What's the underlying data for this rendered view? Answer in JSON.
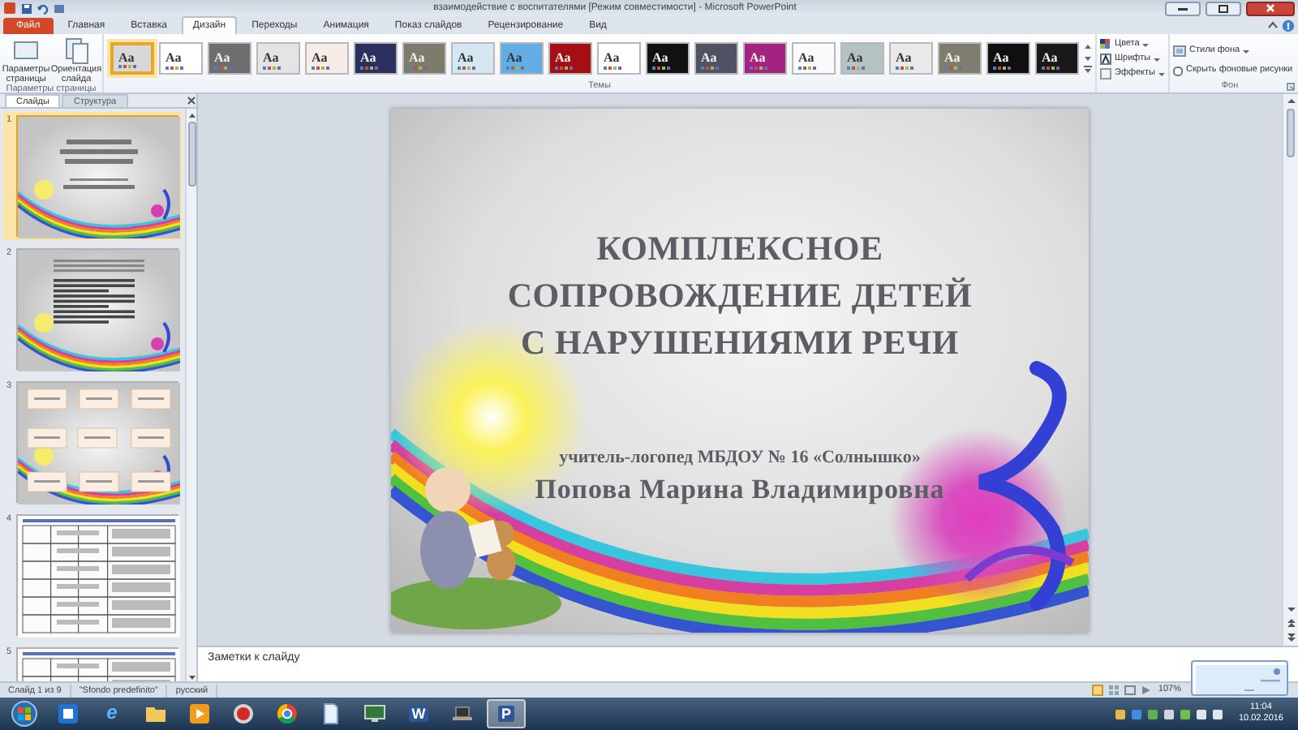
{
  "window": {
    "title": "взаимодействие с воспитателями [Режим совместимости] - Microsoft PowerPoint"
  },
  "ribbon_tabs": [
    {
      "label": "Файл",
      "kind": "file",
      "selected": false
    },
    {
      "label": "Главная",
      "kind": "tab",
      "selected": false
    },
    {
      "label": "Вставка",
      "kind": "tab",
      "selected": false
    },
    {
      "label": "Дизайн",
      "kind": "tab",
      "selected": true
    },
    {
      "label": "Переходы",
      "kind": "tab",
      "selected": false
    },
    {
      "label": "Анимация",
      "kind": "tab",
      "selected": false
    },
    {
      "label": "Показ слайдов",
      "kind": "tab",
      "selected": false
    },
    {
      "label": "Рецензирование",
      "kind": "tab",
      "selected": false
    },
    {
      "label": "Вид",
      "kind": "tab",
      "selected": false
    }
  ],
  "page_setup": {
    "label": "Параметры страницы",
    "buttons": [
      {
        "label": "Параметры страницы",
        "kind": "page"
      },
      {
        "label": "Ориентация слайда",
        "kind": "orientation"
      }
    ]
  },
  "themes": {
    "label": "Темы",
    "items": [
      {
        "label": "Aa",
        "color": "#d8d8d8",
        "selected": true
      },
      {
        "label": "Aa",
        "color": "#ffffff",
        "selected": false
      },
      {
        "label": "Aa",
        "color": "#6e6e70",
        "selected": false
      },
      {
        "label": "Aa",
        "color": "#e4e4e4",
        "selected": false
      },
      {
        "label": "Aa",
        "color": "#f7ece6",
        "selected": false
      },
      {
        "label": "Aa",
        "color": "#2b2f5c",
        "selected": false
      },
      {
        "label": "Aa",
        "color": "#7c7b6c",
        "selected": false
      },
      {
        "label": "Aa",
        "color": "#d5e7f3",
        "selected": false
      },
      {
        "label": "Aa",
        "color": "#62aee4",
        "selected": false
      },
      {
        "label": "Aa",
        "color": "#a30f12",
        "selected": false
      },
      {
        "label": "Aa",
        "color": "#ffffff",
        "selected": false
      },
      {
        "label": "Aa",
        "color": "#111111",
        "selected": false
      },
      {
        "label": "Aa",
        "color": "#4f5262",
        "selected": false
      },
      {
        "label": "Aa",
        "color": "#a32381",
        "selected": false
      },
      {
        "label": "Aa",
        "color": "#fafafa",
        "selected": false
      },
      {
        "label": "Aa",
        "color": "#b4c2c4",
        "selected": false
      },
      {
        "label": "Aa",
        "color": "#e9e9e9",
        "selected": false
      },
      {
        "label": "Aa",
        "color": "#7f7e6e",
        "selected": false
      },
      {
        "label": "Aa",
        "color": "#0f0f12",
        "selected": false
      },
      {
        "label": "Aa",
        "color": "#191919",
        "selected": false
      }
    ]
  },
  "theme_options": [
    {
      "label": "Цвета",
      "kind": "colors"
    },
    {
      "label": "Шрифты",
      "kind": "fonts"
    },
    {
      "label": "Эффекты",
      "kind": "effects"
    }
  ],
  "background": {
    "label": "Фон",
    "styles_button": "Стили фона",
    "hide_graphics": {
      "label": "Скрыть фоновые рисунки",
      "checked": false
    }
  },
  "pane_tabs": [
    {
      "label": "Слайды",
      "selected": true
    },
    {
      "label": "Структура",
      "selected": false
    }
  ],
  "slides": [
    {
      "number": "1",
      "kind": "title",
      "selected": true
    },
    {
      "number": "2",
      "kind": "text",
      "selected": false
    },
    {
      "number": "3",
      "kind": "diagram",
      "selected": false
    },
    {
      "number": "4",
      "kind": "table",
      "selected": false
    },
    {
      "number": "5",
      "kind": "table",
      "selected": false
    }
  ],
  "slide": {
    "title": "КОМПЛЕКСНОЕ\nСОПРОВОЖДЕНИЕ ДЕТЕЙ\nС НАРУШЕНИЯМИ РЕЧИ",
    "subtitle": "учитель-логопед МБДОУ  № 16 «Солнышко»",
    "author": "Попова Марина Владимировна"
  },
  "notes": {
    "placeholder": "Заметки к слайду"
  },
  "status_bar": {
    "slide": "Слайд 1 из 9",
    "theme": "\"Sfondo predefinito\"",
    "language": "русский",
    "zoom": "107%"
  },
  "taskbar": {
    "apps": [
      {
        "kind": "window",
        "selected": false
      },
      {
        "kind": "browser",
        "label": "e",
        "selected": false
      },
      {
        "kind": "folder",
        "selected": false
      },
      {
        "kind": "play",
        "selected": false
      },
      {
        "kind": "record",
        "selected": false
      },
      {
        "kind": "round",
        "selected": false
      },
      {
        "kind": "document",
        "selected": false
      },
      {
        "kind": "monitor",
        "selected": false
      },
      {
        "kind": "letter",
        "label": "W",
        "selected": false
      },
      {
        "kind": "laptop",
        "selected": false
      },
      {
        "kind": "letter",
        "label": "P",
        "selected": true
      }
    ],
    "time": "11:04",
    "date": "10.02.2016"
  }
}
